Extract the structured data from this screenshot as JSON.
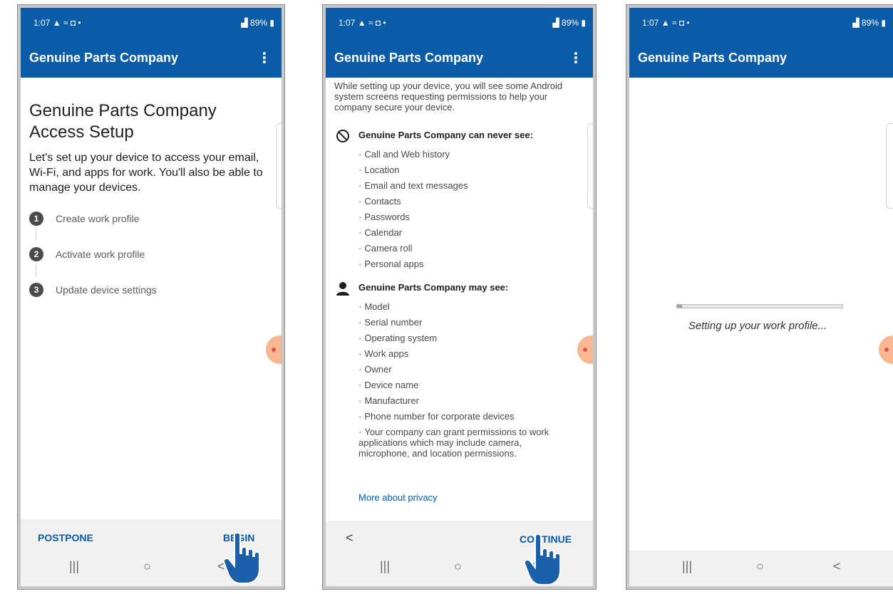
{
  "status_bar": {
    "time": "1:07",
    "indicators": "▲ ≈ ◘ •",
    "battery": "89%",
    "signal": "▟"
  },
  "app": {
    "title": "Genuine Parts Company",
    "menu_icon": "vertical-dots-icon"
  },
  "screen1": {
    "heading": "Genuine Parts Company Access Setup",
    "intro": "Let's set up your device to access your email, Wi-Fi, and apps for work. You'll also be able to manage your devices.",
    "steps": [
      {
        "num": "1",
        "label": "Create work profile"
      },
      {
        "num": "2",
        "label": "Activate work profile"
      },
      {
        "num": "3",
        "label": "Update device settings"
      }
    ],
    "postpone": "POSTPONE",
    "begin": "BEGIN"
  },
  "screen2": {
    "intro": "While setting up your device, you will see some Android system screens requesting permissions to help your company secure your device.",
    "never_heading": "Genuine Parts Company can never see:",
    "never_items": [
      "Call and Web history",
      "Location",
      "Email and text messages",
      "Contacts",
      "Passwords",
      "Calendar",
      "Camera roll",
      "Personal apps"
    ],
    "may_heading": "Genuine Parts Company may see:",
    "may_items": [
      "Model",
      "Serial number",
      "Operating system",
      "Work apps",
      "Owner",
      "Device name",
      "Manufacturer",
      "Phone number for corporate devices",
      "Your company can grant permissions to work applications which may include camera, microphone, and location permissions."
    ],
    "privacy_link": "More about privacy",
    "back": "<",
    "continue": "CONTINUE"
  },
  "screen3": {
    "status": "Setting up your work profile...",
    "progress": 0.03
  },
  "navbar": {
    "recents": "|||",
    "home": "○",
    "back": "<"
  }
}
